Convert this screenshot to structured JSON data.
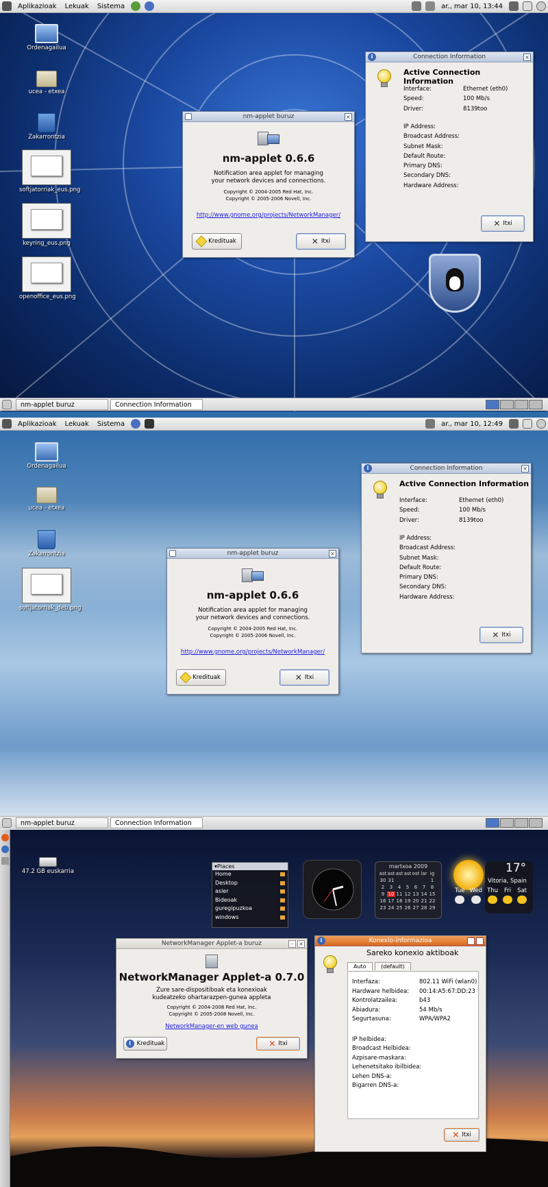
{
  "screen1": {
    "panel": {
      "menus": [
        "Aplikazioak",
        "Lekuak",
        "Sistema"
      ],
      "clock": "ar., mar 10, 13:44"
    },
    "desktop_icons": [
      "Ordenagailua",
      "ucea - etxea",
      "Zakarrontzia",
      "softjatorriak_eus.png",
      "keyring_eus.png",
      "openoffice_eus.png"
    ],
    "about": {
      "title": "nm-applet buruz",
      "name": "nm-applet 0.6.6",
      "desc": [
        "Notification area applet for managing",
        "your network devices and connections."
      ],
      "copyright": [
        "Copyright © 2004-2005 Red Hat, Inc.",
        "Copyright © 2005-2006 Novell, Inc."
      ],
      "link": "http://www.gnome.org/projects/NetworkManager/",
      "credits": "Kredituak",
      "close": "Itxi"
    },
    "conn": {
      "title": "Connection Information",
      "heading": "Active Connection Information",
      "rows": [
        {
          "label": "Interface:",
          "value": "Ethernet (eth0)"
        },
        {
          "label": "Speed:",
          "value": "100 Mb/s"
        },
        {
          "label": "Driver:",
          "value": "8139too"
        },
        {
          "label": "IP Address:",
          "value": ""
        },
        {
          "label": "Broadcast Address:",
          "value": ""
        },
        {
          "label": "Subnet Mask:",
          "value": ""
        },
        {
          "label": "Default Route:",
          "value": ""
        },
        {
          "label": "Primary DNS:",
          "value": ""
        },
        {
          "label": "Secondary DNS:",
          "value": ""
        },
        {
          "label": "Hardware Address:",
          "value": ""
        }
      ],
      "close": "Itxi"
    },
    "tasks": [
      "nm-applet buruz",
      "Connection Information"
    ]
  },
  "screen2": {
    "panel": {
      "menus": [
        "Aplikazioak",
        "Lekuak",
        "Sistema"
      ],
      "clock": "ar., mar 10, 12:49"
    },
    "desktop_icons": [
      "Ordenagailua",
      "ucea - etxea",
      "Zakarrontzia",
      "softjatorriak_deb.png"
    ],
    "tasks": [
      "nm-applet buruz",
      "Connection Information"
    ]
  },
  "screen3": {
    "drive": "47.2 GB euskarria",
    "places": {
      "title": "Places",
      "items": [
        "Home",
        "Desktop",
        "asier",
        "Bideoak",
        "guregipuzkoa",
        "windows"
      ]
    },
    "calendar": {
      "month": "martxoa 2009",
      "days_head": [
        "ast",
        "ast",
        "ast",
        "ast",
        "ost",
        "lar",
        "ig"
      ],
      "days": [
        "30",
        "31",
        "",
        "",
        "",
        "",
        "1",
        "2",
        "3",
        "4",
        "5",
        "6",
        "7",
        "8",
        "9",
        "10",
        "11",
        "12",
        "13",
        "14",
        "15",
        "16",
        "17",
        "18",
        "19",
        "20",
        "21",
        "22",
        "23",
        "24",
        "25",
        "26",
        "27",
        "28",
        "29"
      ],
      "today": "10"
    },
    "weather": {
      "temp": "17°",
      "location": "Vitoria, Spain",
      "days": [
        "Tue",
        "Wed",
        "Thu",
        "Fri",
        "Sat"
      ]
    },
    "about": {
      "title": "NetworkManager Applet-a buruz",
      "name": "NetworkManager Applet-a 0.7.0",
      "desc": [
        "Zure sare-dispositiboak eta konexioak",
        "kudeatzeko ohartarazpen-gunea appleta"
      ],
      "copyright": [
        "Copyright © 2004-2008 Red Hat, Inc.",
        "Copyright © 2005-2008 Novell, Inc."
      ],
      "link": "NetworkManager-en web gunea",
      "credits": "Kredituak",
      "close": "Itxi"
    },
    "conn": {
      "title": "Konexio-informazioa",
      "heading": "Sareko konexio aktiboak",
      "tabs": [
        "Auto",
        "(default)"
      ],
      "rows": [
        {
          "label": "Interfaza:",
          "value": "802.11 WiFi (wlan0)"
        },
        {
          "label": "Hardware helbidea:",
          "value": "00:14:A5:67:DD:23"
        },
        {
          "label": "Kontrolatzailea:",
          "value": "b43"
        },
        {
          "label": "Abiadura:",
          "value": "54 Mb/s"
        },
        {
          "label": "Segurtasuna:",
          "value": "WPA/WPA2"
        },
        {
          "label": "IP helbidea:",
          "value": ""
        },
        {
          "label": "Broadcast Helbidea:",
          "value": ""
        },
        {
          "label": "Azpisare-maskara:",
          "value": ""
        },
        {
          "label": "Lehenetsitako ibilbidea:",
          "value": ""
        },
        {
          "label": "Lehen DNS-a:",
          "value": ""
        },
        {
          "label": "Bigarren DNS-a:",
          "value": ""
        }
      ],
      "close": "Itxi"
    }
  },
  "colors": {
    "screen1_bg": "#0b2a66",
    "screen2_bg": "#5d8fc0",
    "screen3_bg": "#0b1330",
    "link": "#1a1ae0"
  }
}
